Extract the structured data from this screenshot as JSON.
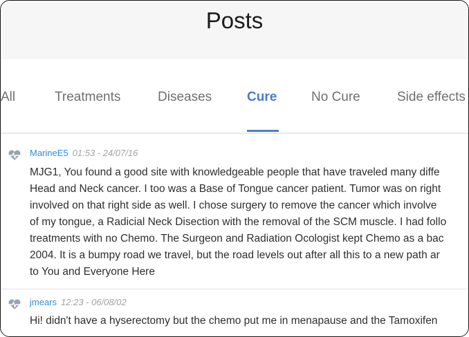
{
  "page": {
    "title": "Posts"
  },
  "tabs": [
    {
      "label": "All",
      "active": false
    },
    {
      "label": "Treatments",
      "active": false
    },
    {
      "label": "Diseases",
      "active": false
    },
    {
      "label": "Cure",
      "active": true
    },
    {
      "label": "No Cure",
      "active": false
    },
    {
      "label": "Side effects",
      "active": false
    }
  ],
  "colors": {
    "accent": "#4a7dc5",
    "author": "#2f8fd8",
    "header_bg": "#f6f6f6"
  },
  "posts": [
    {
      "author": "MarineE5",
      "timestamp": "01:53 - 24/07/16",
      "avatar_icon": "heart-pulse-icon",
      "lines": [
        "MJG1, You found a good site with knowledgeable people that have traveled many diffe",
        "Head and Neck cancer. I too was a Base of Tongue cancer patient. Tumor was on right",
        "involved on that right side as well. I chose surgery to remove the cancer which involve",
        "of my tongue, a Radicial Neck Disection with the removal of the SCM muscle. I had follo",
        "treatments with no Chemo. The Surgeon and Radiation Ocologist kept Chemo as a bac",
        "2004. It is a bumpy road we travel, but the road levels out after all this to a new path ar",
        "to You and Everyone Here"
      ]
    },
    {
      "author": "jmears",
      "timestamp": "12:23 - 06/08/02",
      "avatar_icon": "heart-pulse-icon",
      "lines": [
        "Hi! didn't have a hyserectomy but the chemo put me in menapause and the Tamoxifen"
      ]
    }
  ]
}
